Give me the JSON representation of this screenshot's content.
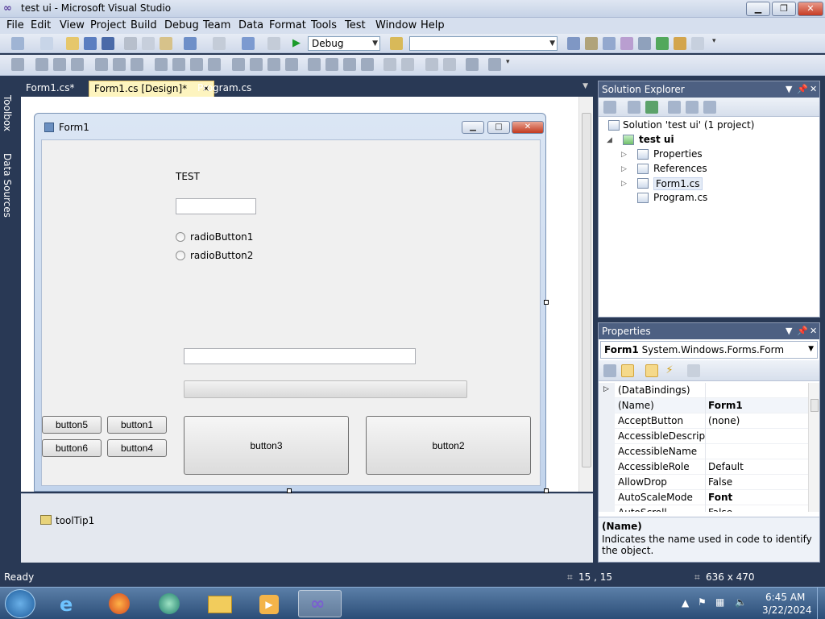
{
  "window": {
    "title": "test ui - Microsoft Visual Studio"
  },
  "menu": [
    "File",
    "Edit",
    "View",
    "Project",
    "Build",
    "Debug",
    "Team",
    "Data",
    "Format",
    "Tools",
    "Test",
    "Window",
    "Help"
  ],
  "toolbar": {
    "config": "Debug",
    "platform": ""
  },
  "left_strip": {
    "toolbox": "Toolbox",
    "data_sources": "Data Sources"
  },
  "doc_tabs": [
    "Form1.cs*",
    "Form1.cs [Design]*",
    "Program.cs"
  ],
  "form": {
    "title": "Form1",
    "label": "TEST",
    "radio1": "radioButton1",
    "radio2": "radioButton2",
    "buttons": {
      "b5": "button5",
      "b1": "button1",
      "b6": "button6",
      "b4": "button4",
      "b3": "button3",
      "b2": "button2"
    }
  },
  "tray": {
    "component": "toolTip1"
  },
  "solution_explorer": {
    "title": "Solution Explorer",
    "solution": "Solution 'test ui' (1 project)",
    "project": "test ui",
    "items": [
      "Properties",
      "References",
      "Form1.cs",
      "Program.cs"
    ]
  },
  "properties": {
    "title": "Properties",
    "object_name": "Form1",
    "object_type": "System.Windows.Forms.Form",
    "rows": [
      {
        "name": "(DataBindings)",
        "value": ""
      },
      {
        "name": "(Name)",
        "value": "Form1"
      },
      {
        "name": "AcceptButton",
        "value": "(none)"
      },
      {
        "name": "AccessibleDescriptic",
        "value": ""
      },
      {
        "name": "AccessibleName",
        "value": ""
      },
      {
        "name": "AccessibleRole",
        "value": "Default"
      },
      {
        "name": "AllowDrop",
        "value": "False"
      },
      {
        "name": "AutoScaleMode",
        "value": "Font"
      },
      {
        "name": "AutoScroll",
        "value": "False"
      }
    ],
    "desc_title": "(Name)",
    "desc_text": "Indicates the name used in code to identify the object."
  },
  "status": {
    "text": "Ready",
    "position": "15 , 15",
    "size": "636 x 470"
  },
  "taskbar": {
    "time": "6:45 AM",
    "date": "3/22/2024"
  }
}
